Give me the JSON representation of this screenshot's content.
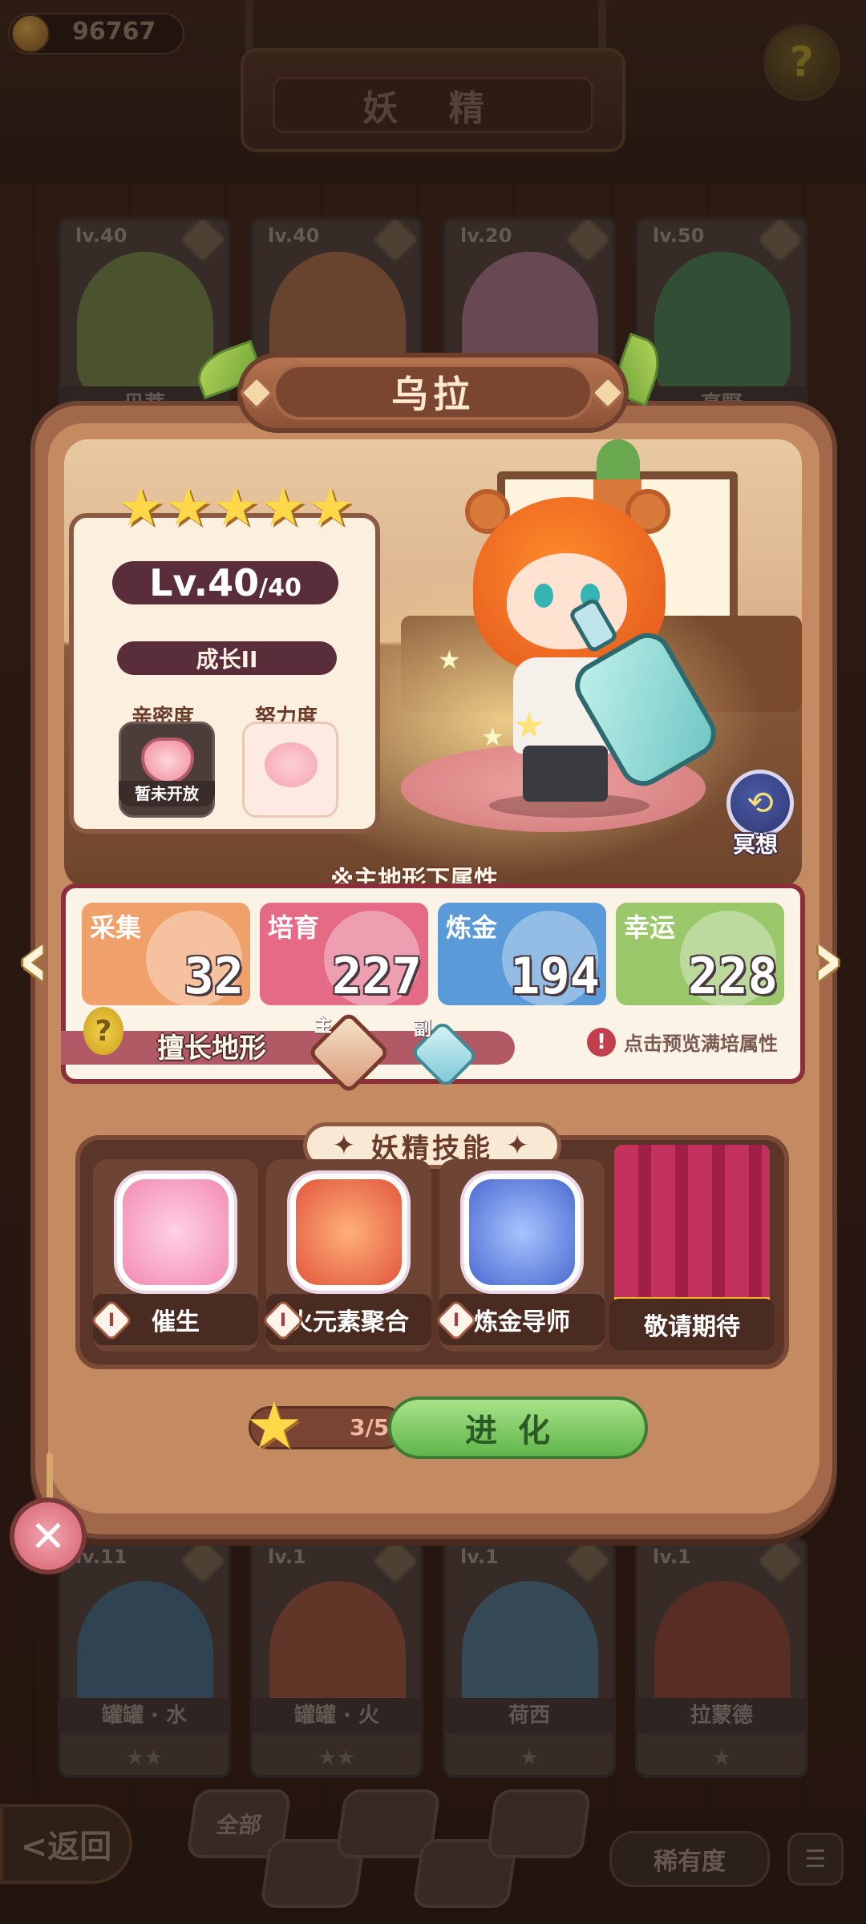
{
  "top_bar": {
    "coins": "96767",
    "title": "妖 精"
  },
  "background_cards_top": [
    {
      "level": "lv.40",
      "name": "贝蒂",
      "color": "#7ea14a"
    },
    {
      "level": "lv.40",
      "name": "",
      "color": "#c97a4a"
    },
    {
      "level": "lv.20",
      "name": "",
      "color": "#c98aa6"
    },
    {
      "level": "lv.50",
      "name": "高野",
      "color": "#3f9a5a"
    }
  ],
  "background_cards_bottom": [
    {
      "level": "lv.11",
      "name": "罐罐 · 水",
      "stars": "★★",
      "color": "#3a7aa6"
    },
    {
      "level": "lv.1",
      "name": "罐罐 · 火",
      "stars": "★★",
      "color": "#b5573a"
    },
    {
      "level": "lv.1",
      "name": "荷西",
      "stars": "★",
      "color": "#4a8ab0"
    },
    {
      "level": "lv.1",
      "name": "拉蒙德",
      "stars": "★",
      "color": "#a0432e"
    }
  ],
  "bottom_bar": {
    "back_label": "<返回",
    "filter_all": "全部",
    "sort_label": "稀有度"
  },
  "fairy": {
    "name": "乌拉",
    "stars": "★★★★★",
    "level": "Lv.40",
    "level_max": "/40",
    "growth": "成长II",
    "intimacy_label": "亲密度",
    "intimacy_status": "暂未开放",
    "effort_label": "努力度",
    "meditate_label": "冥想"
  },
  "attributes": {
    "title": "※主地形下属性",
    "items": [
      {
        "label": "采集",
        "value": "32",
        "color": "#f0a06a"
      },
      {
        "label": "培育",
        "value": "227",
        "color": "#e46a86"
      },
      {
        "label": "炼金",
        "value": "194",
        "color": "#5a9ad8"
      },
      {
        "label": "幸运",
        "value": "228",
        "color": "#9ac76a"
      }
    ],
    "terrain_label": "擅长地形",
    "terrain_main": "主",
    "terrain_sub": "副",
    "preview_text": "点击预览满培属性"
  },
  "skills": {
    "title": "妖精技能",
    "items": [
      {
        "name": "催生",
        "tag": "I",
        "color": "#f28ab0"
      },
      {
        "name": "火元素聚合",
        "tag": "I",
        "color": "#e2563c"
      },
      {
        "name": "炼金导师",
        "tag": "I",
        "color": "#4a6ad0"
      }
    ],
    "coming_soon": "敬请期待"
  },
  "evolve": {
    "progress": "3/5",
    "button": "进化"
  }
}
